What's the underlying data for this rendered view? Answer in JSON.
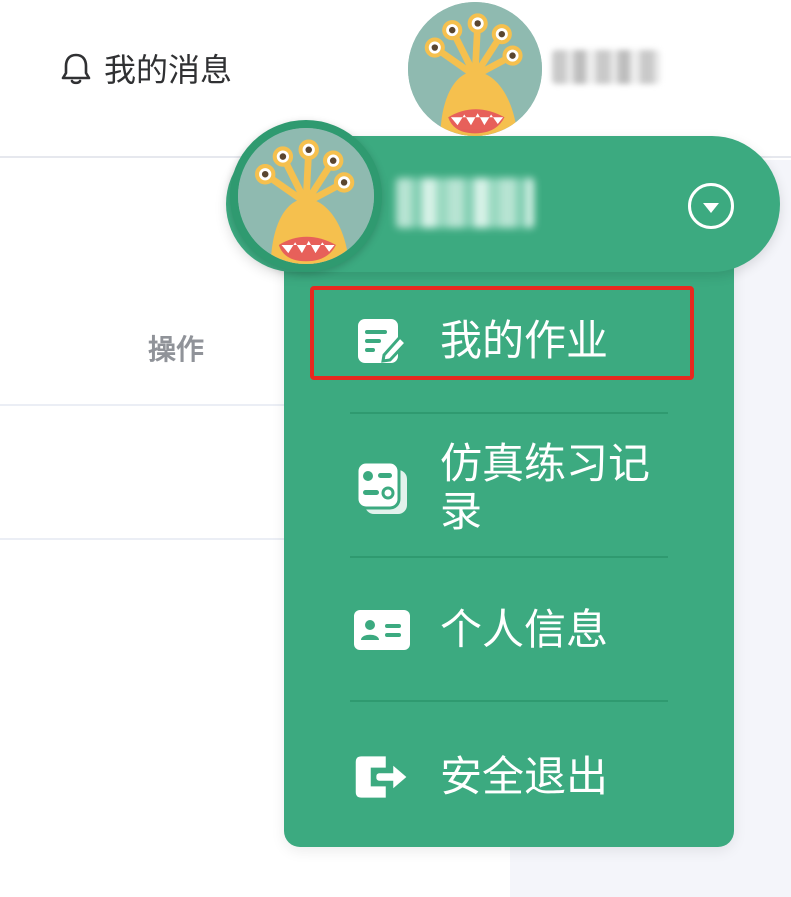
{
  "header": {
    "messages_label": "我的消息",
    "bell_icon": "bell-icon",
    "avatar_icon": "monster-avatar"
  },
  "table": {
    "column_operation": "操作"
  },
  "user_menu": {
    "toggle_icon": "chevron-down-circle-icon",
    "items": [
      {
        "label": "我的作业",
        "icon": "homework-edit-icon"
      },
      {
        "label": "仿真练习记录",
        "icon": "practice-record-icon"
      },
      {
        "label": "个人信息",
        "icon": "id-card-icon"
      },
      {
        "label": "安全退出",
        "icon": "logout-icon"
      }
    ]
  },
  "colors": {
    "menu_green": "#3caa80",
    "highlight_red": "#e8281f",
    "avatar_bg": "#8fbab0",
    "monster_yellow": "#f5c04e"
  }
}
